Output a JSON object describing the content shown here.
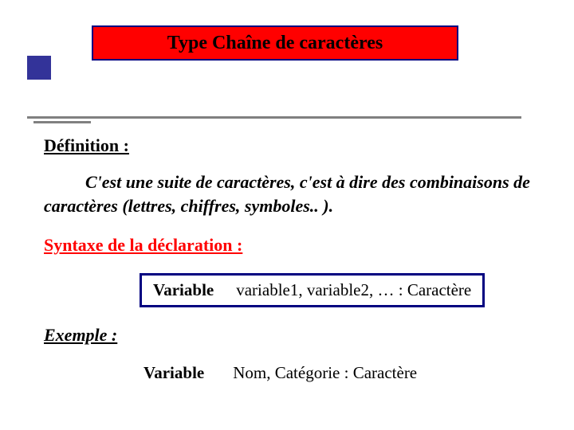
{
  "title": "Type Chaîne de caractères",
  "definition": {
    "heading": "Définition :",
    "body": "C'est une suite de caractères, c'est à dire des combinaisons de caractères (lettres, chiffres, symboles.. )."
  },
  "syntax": {
    "heading": "Syntaxe de la déclaration :",
    "keyword": "Variable",
    "args": "variable1, variable2, … : Caractère"
  },
  "example": {
    "heading": "Exemple :",
    "keyword": "Variable",
    "args": "Nom, Catégorie  : Caractère"
  }
}
